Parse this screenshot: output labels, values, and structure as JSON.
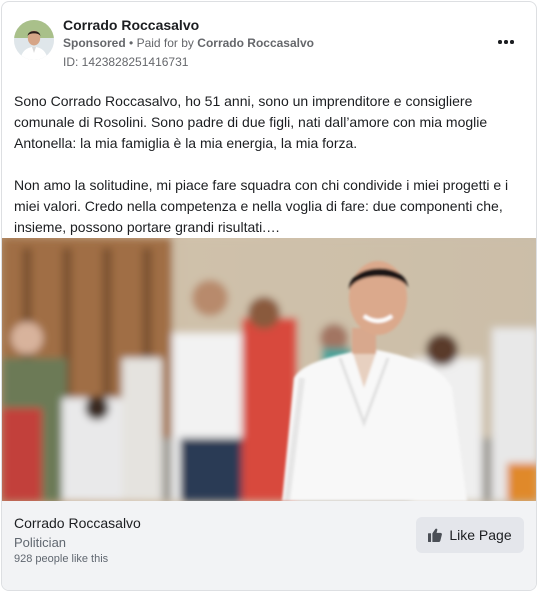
{
  "post": {
    "page_name": "Corrado Roccasalvo",
    "sponsored_label": "Sponsored",
    "separator": "•",
    "paid_for_prefix": "Paid for by",
    "paid_for_by": "Corrado Roccasalvo",
    "ad_id": "ID: 1423828251416731",
    "more_icon": "more-horizontal-icon",
    "paragraphs": [
      "Sono Corrado Roccasalvo, ho 51 anni, sono un imprenditore e consigliere comunale di Rosolini. Sono padre di due figli, nati dall’amore con mia moglie Antonella: la mia famiglia è la mia energia, la mia forza.",
      "Non amo la solitudine, mi piace fare squadra con chi condivide i miei progetti e i miei valori. Credo nella competenza e nella voglia di fare: due componenti che, insieme, possono portare grandi risultati.…"
    ]
  },
  "footer": {
    "name": "Corrado Roccasalvo",
    "category": "Politician",
    "likes": "928 people like this",
    "like_button_label": "Like Page",
    "like_icon": "thumbs-up-icon"
  },
  "colors": {
    "text": "#1c1e21",
    "secondary": "#65676b",
    "footer_bg": "#f2f3f5",
    "button_bg": "#e4e6eb",
    "border": "#dddfe2"
  }
}
